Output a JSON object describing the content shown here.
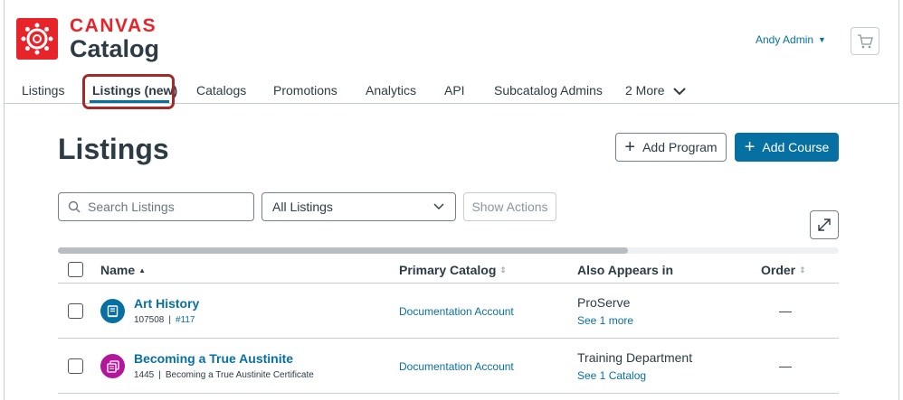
{
  "brand": {
    "line1": "CANVAS",
    "line2": "Catalog",
    "logo_icon": "canvas-logo-icon",
    "color": "#e72429"
  },
  "header": {
    "user_name": "Andy Admin",
    "cart_icon": "shopping-cart-icon"
  },
  "nav": {
    "items": [
      {
        "label": "Listings"
      },
      {
        "label": "Listings (new)",
        "active": true
      },
      {
        "label": "Catalogs"
      },
      {
        "label": "Promotions"
      },
      {
        "label": "Analytics"
      },
      {
        "label": "API"
      },
      {
        "label": "Subcatalog Admins"
      },
      {
        "label": "2 More"
      }
    ]
  },
  "page": {
    "title": "Listings",
    "add_program_label": "Add Program",
    "add_course_label": "Add Course"
  },
  "filters": {
    "search_placeholder": "Search Listings",
    "select_value": "All Listings",
    "show_actions_label": "Show Actions"
  },
  "table": {
    "columns": {
      "name": "Name",
      "primary_catalog": "Primary Catalog",
      "also_appears": "Also Appears in",
      "order": "Order"
    },
    "rows": [
      {
        "name": "Art History",
        "id": "107508",
        "secondary": "#117",
        "primary_catalog": "Documentation Account",
        "also_appears": "ProServe",
        "see_more": "See 1 more",
        "order": "—",
        "badge_color": "#0770a3",
        "badge_icon": "course-icon"
      },
      {
        "name": "Becoming a True Austinite",
        "id": "1445",
        "secondary": "Becoming a True Austinite Certificate",
        "primary_catalog": "Documentation Account",
        "also_appears": "Training Department",
        "see_more": "See 1 Catalog",
        "order": "—",
        "badge_color": "#b2169b",
        "badge_icon": "program-icon"
      }
    ]
  },
  "colors": {
    "accent": "#0770a3",
    "highlight": "#a42a2a"
  }
}
